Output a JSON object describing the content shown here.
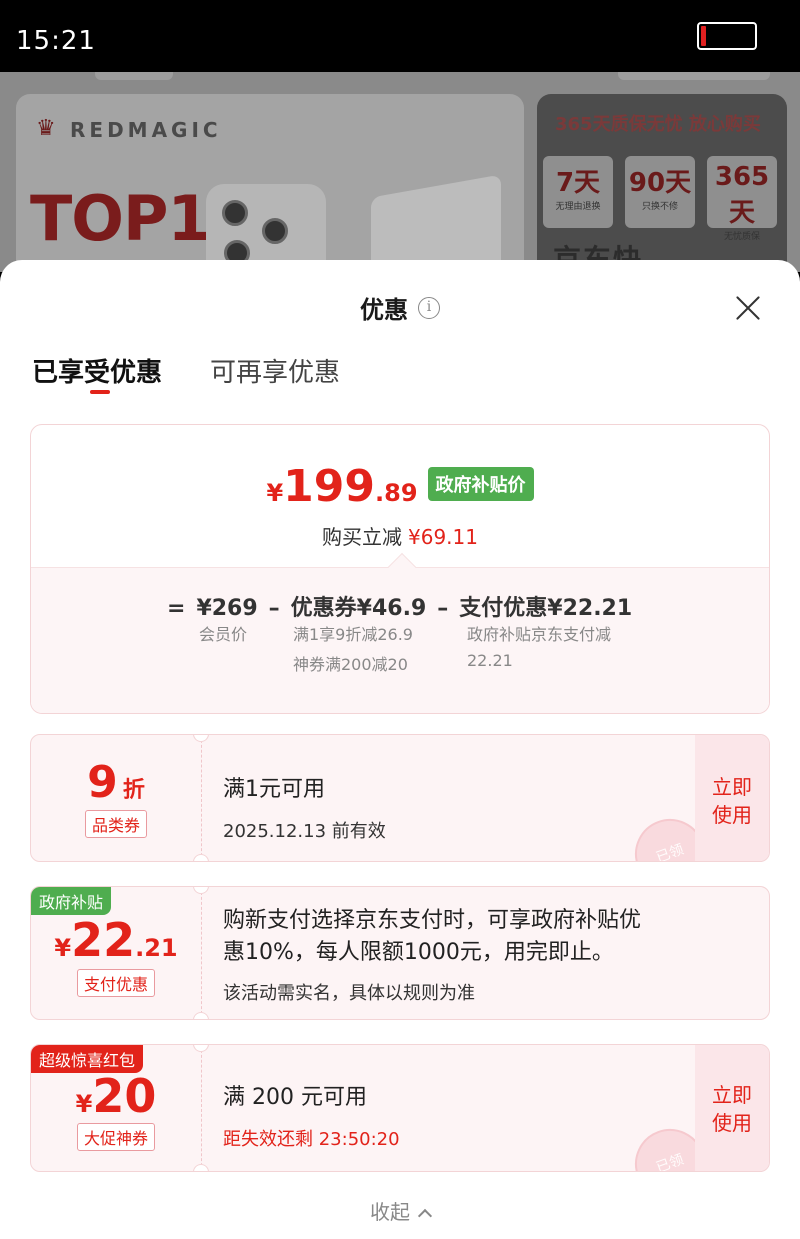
{
  "status_bar": {
    "time": "15:21",
    "battery_level": 0.1,
    "battery_color": "#e02020"
  },
  "background": {
    "brand": "REDMAGIC",
    "headline": "TOP1",
    "right_title": "365天质保无忧 放心购买",
    "right_boxes": [
      {
        "num": "7天",
        "label": "无理由退换"
      },
      {
        "num": "90天",
        "label": "只换不修"
      },
      {
        "num": "365天",
        "label": "无忧质保"
      }
    ],
    "right_bottom": "京东快"
  },
  "sheet": {
    "title": "优惠",
    "info_icon": "i",
    "tabs": [
      {
        "label": "已享受优惠",
        "active": true
      },
      {
        "label": "可再享优惠",
        "active": false
      }
    ],
    "summary": {
      "currency": "¥",
      "price_int": "199",
      "price_dec": ".89",
      "badge": "政府补贴价",
      "reduce_label": "购买立减",
      "reduce_amount": "¥69.11",
      "formula": {
        "eq": "=",
        "base": "¥269",
        "minus1": "–",
        "coupon": "优惠券¥46.9",
        "minus2": "–",
        "pay": "支付优惠¥22.21",
        "base_note": "会员价",
        "coupon_note_1": "满1享9折减26.9",
        "coupon_note_2": "神券满200减20",
        "pay_note_1": "政府补贴京东支付减",
        "pay_note_2": "22.21"
      }
    },
    "coupons": [
      {
        "big": "9",
        "big_suffix": "折",
        "tag": "品类券",
        "line1": "满1元可用",
        "line2": "2025.12.13 前有效",
        "action": [
          "立即",
          "使用"
        ],
        "stamp": "已领"
      },
      {
        "flag": "政府补贴",
        "currency": "¥",
        "big": "22",
        "big_suffix": ".21",
        "tag": "支付优惠",
        "line1": "购新支付选择京东支付时，可享政府补贴优",
        "line1b": "惠10%，每人限额1000元，用完即止。",
        "line2": "该活动需实名，具体以规则为准"
      },
      {
        "flag": "超级惊喜红包",
        "currency": "¥",
        "big": "20",
        "tag": "大促神券",
        "line1": "满 200 元可用",
        "line2": "距失效还剩 23:50:20",
        "action": [
          "立即",
          "使用"
        ],
        "stamp": "已领"
      }
    ],
    "collapse": "收起"
  },
  "colors": {
    "accent": "#e2231a",
    "green_badge": "#4fad4f",
    "flag_green": "#4fad4f",
    "flag_red": "#e2231a"
  }
}
